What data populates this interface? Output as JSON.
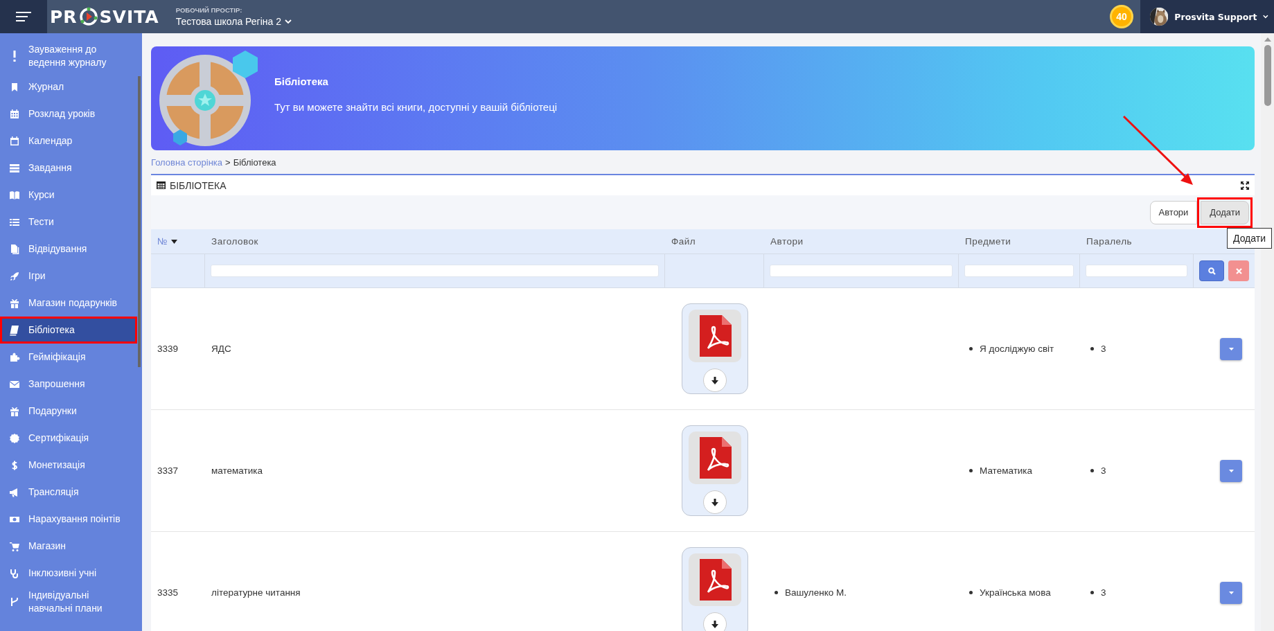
{
  "topbar": {
    "logo_start": "PR",
    "logo_end": "SVITA",
    "workspace_label": "РОБОЧИЙ ПРОСТІР:",
    "workspace": "Тестова школа Регіна 2",
    "points": "40",
    "user": "Prosvita Support"
  },
  "sidebar": {
    "items": [
      {
        "label": "Зауваження до ведення журналу",
        "selected": false,
        "highlighted": false
      },
      {
        "label": "Журнал",
        "selected": false,
        "highlighted": false
      },
      {
        "label": "Розклад уроків",
        "selected": false,
        "highlighted": false
      },
      {
        "label": "Календар",
        "selected": false,
        "highlighted": false
      },
      {
        "label": "Завдання",
        "selected": false,
        "highlighted": false
      },
      {
        "label": "Курси",
        "selected": false,
        "highlighted": false
      },
      {
        "label": "Тести",
        "selected": false,
        "highlighted": false
      },
      {
        "label": "Відвідування",
        "selected": false,
        "highlighted": false
      },
      {
        "label": "Ігри",
        "selected": false,
        "highlighted": false
      },
      {
        "label": "Магазин подарунків",
        "selected": false,
        "highlighted": false
      },
      {
        "label": "Бібліотека",
        "selected": true,
        "highlighted": true
      },
      {
        "label": "Гейміфікація",
        "selected": false,
        "highlighted": false
      },
      {
        "label": "Запрошення",
        "selected": false,
        "highlighted": false
      },
      {
        "label": "Подарунки",
        "selected": false,
        "highlighted": false
      },
      {
        "label": "Сертифікація",
        "selected": false,
        "highlighted": false
      },
      {
        "label": "Монетизація",
        "selected": false,
        "highlighted": false
      },
      {
        "label": "Трансляція",
        "selected": false,
        "highlighted": false
      },
      {
        "label": "Нарахування поінтів",
        "selected": false,
        "highlighted": false
      },
      {
        "label": "Магазин",
        "selected": false,
        "highlighted": false
      },
      {
        "label": "Інклюзивні учні",
        "selected": false,
        "highlighted": false
      },
      {
        "label": "Індивідуальні навчальні плани",
        "selected": false,
        "highlighted": false
      }
    ]
  },
  "banner": {
    "title": "Бібліотека",
    "text": "Тут ви можете знайти всі книги, доступні у вашій бібліотеці"
  },
  "breadcrumb": [
    {
      "label": "Головна сторінка",
      "kind": "link"
    },
    {
      "label": ">",
      "kind": "separator"
    },
    {
      "label": "Бібліотека",
      "kind": "current"
    }
  ],
  "panel": {
    "title": "БІБЛІОТЕКА",
    "buttons": [
      {
        "label": "Автори",
        "highlighted": false
      },
      {
        "label": "Додати",
        "highlighted": true
      }
    ],
    "tooltip": "Додати"
  },
  "table": {
    "columns": [
      {
        "label": "№",
        "sorted": true,
        "filter": false
      },
      {
        "label": "Заголовок",
        "sorted": false,
        "filter": true
      },
      {
        "label": "Файл",
        "sorted": false,
        "filter": false
      },
      {
        "label": "Автори",
        "sorted": false,
        "filter": true
      },
      {
        "label": "Предмети",
        "sorted": false,
        "filter": true
      },
      {
        "label": "Паралель",
        "sorted": false,
        "filter": true
      }
    ],
    "rows": [
      {
        "id": "3339",
        "title": "ЯДС",
        "subjects": [
          "Я досліджую світ"
        ],
        "parallels": [
          "3"
        ]
      },
      {
        "id": "3337",
        "title": "математика",
        "subjects": [
          "Математика"
        ],
        "parallels": [
          "3"
        ]
      },
      {
        "id": "3335",
        "title": "літературне читання",
        "authors": [
          "Вашуленко М."
        ],
        "subjects": [
          "Українська мова"
        ],
        "parallels": [
          "3"
        ]
      }
    ]
  },
  "annotation": {
    "kind": "arrow"
  }
}
